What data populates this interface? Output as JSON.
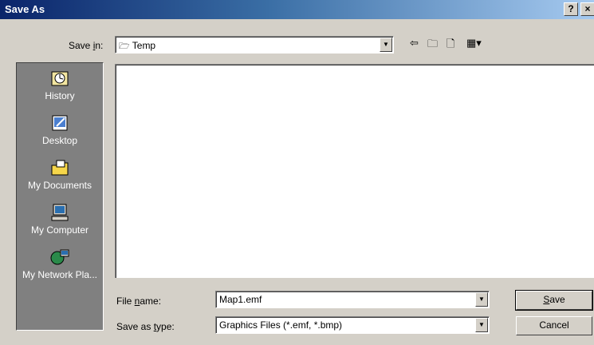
{
  "window": {
    "title": "Save As",
    "help_label": "?",
    "close_label": "×"
  },
  "save_in": {
    "label_pre": "Save ",
    "label_key": "i",
    "label_post": "n:",
    "value": "Temp"
  },
  "toolbar": {
    "back_icon": "⇦",
    "up_folder_icon": "🗀",
    "new_folder_icon": "🗋",
    "views_icon": "▦▾"
  },
  "places": [
    {
      "label": "History",
      "icon": "history-icon"
    },
    {
      "label": "Desktop",
      "icon": "desktop-icon"
    },
    {
      "label": "My Documents",
      "icon": "my-documents-icon"
    },
    {
      "label": "My Computer",
      "icon": "my-computer-icon"
    },
    {
      "label": "My Network Pla...",
      "icon": "my-network-places-icon"
    }
  ],
  "file_name": {
    "label_pre": "File ",
    "label_key": "n",
    "label_post": "ame:",
    "value": "Map1.emf"
  },
  "save_as_type": {
    "label_pre": "Save as ",
    "label_key": "t",
    "label_post": "ype:",
    "value": "Graphics Files (*.emf, *.bmp)"
  },
  "buttons": {
    "save_key": "S",
    "save_rest": "ave",
    "cancel": "Cancel"
  }
}
